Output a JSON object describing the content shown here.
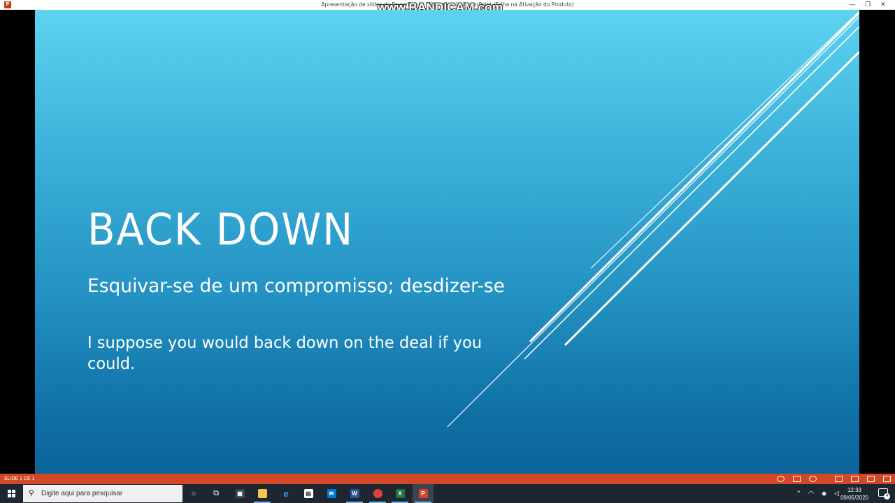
{
  "window": {
    "title": "Apresentação de slides do PowerPoint - [Exemplo...] - PowerPoint (Falha na Ativação do Produto)",
    "watermark": "www.BANDICAM.com",
    "app_icon": "powerpoint-icon"
  },
  "slide": {
    "title": "BACK DOWN",
    "subtitle": "Esquivar-se de um compromisso; desdizer-se",
    "example": "I suppose you would back down on the deal if you could.",
    "background_top": "#5dd3ef",
    "background_bottom": "#0c649b"
  },
  "statusbar": {
    "slide_count": "SLIDE 1 DE 1",
    "color": "#d24726",
    "icons": [
      "previous-icon",
      "notes-icon",
      "next-icon",
      "normal-view-icon",
      "slide-sorter-icon",
      "reading-view-icon",
      "slideshow-icon"
    ]
  },
  "taskbar": {
    "search_placeholder": "Digite aqui para pesquisar",
    "apps": [
      "cortana-icon",
      "task-view-icon",
      "calculator-icon",
      "file-explorer-icon",
      "edge-icon",
      "store-icon",
      "mail-icon",
      "word-icon",
      "chrome-icon",
      "excel-icon",
      "powerpoint-icon"
    ],
    "clock_time": "12:33",
    "clock_date": "09/05/2020",
    "notification_count": "4"
  }
}
